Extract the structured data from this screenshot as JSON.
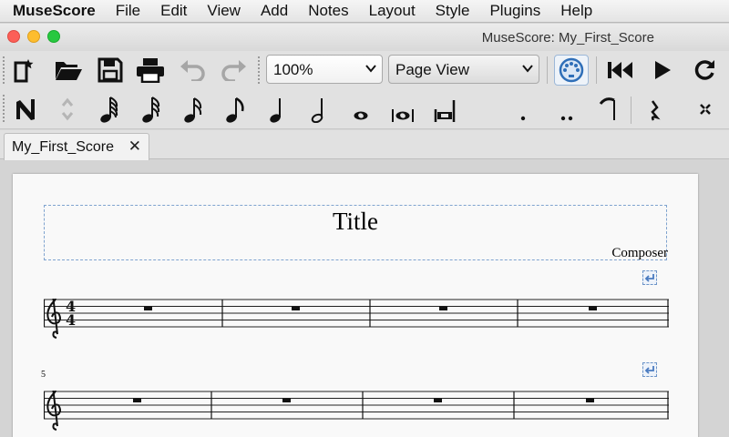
{
  "menubar": {
    "app_name": "MuseScore",
    "items": [
      "File",
      "Edit",
      "View",
      "Add",
      "Notes",
      "Layout",
      "Style",
      "Plugins",
      "Help"
    ]
  },
  "window": {
    "title": "MuseScore: My_First_Score"
  },
  "toolbar": {
    "icons": [
      "new-score-icon",
      "open-icon",
      "save-icon",
      "print-icon",
      "undo-icon",
      "redo-icon"
    ],
    "zoom": "100%",
    "view_mode": "Page View",
    "playback_icons": [
      "midi-input-icon",
      "rewind-icon",
      "play-icon",
      "loop-icon"
    ]
  },
  "note_input": {
    "icons": [
      "note-input-icon",
      "note-input-mode-icon",
      "64th-note-icon",
      "32nd-note-icon",
      "16th-note-icon",
      "eighth-note-icon",
      "quarter-note-icon",
      "half-note-icon",
      "whole-note-icon",
      "breve-icon",
      "longa-icon",
      "augmentation-dot-icon",
      "double-dot-icon",
      "tie-icon",
      "rest-icon",
      "flip-direction-icon"
    ]
  },
  "tabs": [
    {
      "label": "My_First_Score",
      "close_glyph": "✕"
    }
  ],
  "score": {
    "title": "Title",
    "composer": "Composer",
    "time_signature": {
      "top": "4",
      "bottom": "4"
    },
    "systems": [
      {
        "measure_number": "",
        "measures": 4
      },
      {
        "measure_number": "5",
        "measures": 4
      }
    ]
  },
  "colors": {
    "selection_frame": "#7fa3cf",
    "paper": "#f9f9f9",
    "canvas": "#d4d4d4"
  }
}
